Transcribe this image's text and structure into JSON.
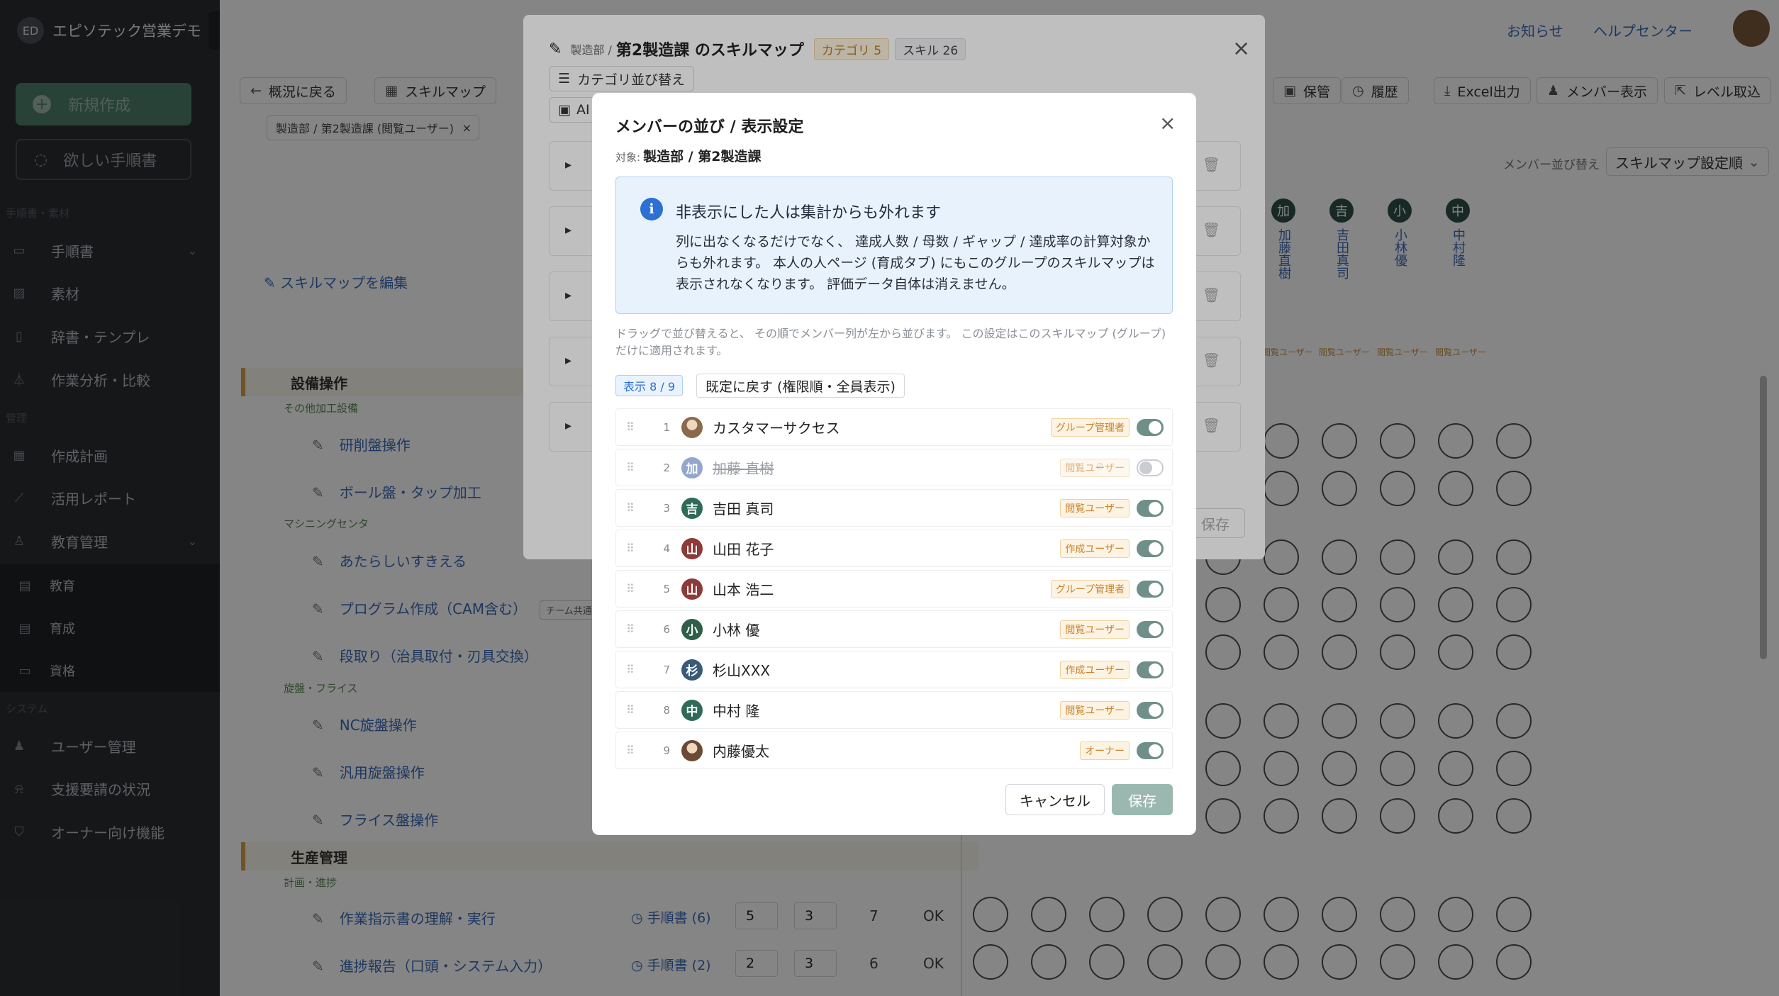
{
  "sidebar": {
    "org_name": "エピソテック営業デモ",
    "logo_text": "ED",
    "new_button": "新規作成",
    "want_button": "欲しい手順書",
    "section_manual": "手順書・素材",
    "section_manage": "管理",
    "section_system": "システム",
    "items": {
      "manual": "手順書",
      "material": "素材",
      "dictionary": "辞書・テンプレ",
      "analysis": "作業分析・比較",
      "plan": "作成計画",
      "report": "活用レポート",
      "education": "教育管理",
      "edu_sub": "教育",
      "training_sub": "育成",
      "qualification_sub": "資格",
      "users": "ユーザー管理",
      "support": "支援要請の状況",
      "owner": "オーナー向け機能"
    }
  },
  "topbar": {
    "news": "お知らせ",
    "help": "ヘルプセンター"
  },
  "toolbar": {
    "back": "概況に戻る",
    "skillmap": "スキルマップ",
    "archive": "保管",
    "history": "履歴",
    "excel": "Excel出力",
    "members": "メンバー表示",
    "level_import": "レベル取込"
  },
  "filter_chip": "製造部 / 第2製造課 (閲覧ユーザー)",
  "edit_skillmap": "スキルマップを編集",
  "member_sort_label": "メンバー並び替え",
  "member_sort_value": "スキルマップ設定順",
  "background": {
    "categories": [
      {
        "name": "設備操作"
      },
      {
        "name": "生産管理"
      }
    ],
    "subcategories": [
      "その他加工設備",
      "マシニングセンタ",
      "旋盤・フライス",
      "計画・進捗"
    ],
    "skills": [
      "研削盤操作",
      "ボール盤・タップ加工",
      "あたらしいすきえる",
      "プログラム作成（CAM含む）",
      "段取り（治具取付・刃具交換）",
      "NC旋盤操作",
      "汎用旋盤操作",
      "フライス盤操作",
      "作業指示書の理解・実行",
      "進捗報告（口頭・システム入力）"
    ],
    "team_tag": "チーム共通",
    "manual_links": [
      "手順書 (6)",
      "手順書 (2)"
    ],
    "nums": [
      [
        "5",
        "3",
        "7",
        "OK"
      ],
      [
        "2",
        "3",
        "6",
        "OK"
      ]
    ],
    "member_columns": [
      {
        "initial": "加",
        "name": "加藤直樹"
      },
      {
        "initial": "吉",
        "name": "吉田真司"
      },
      {
        "initial": "小",
        "name": "小林優"
      },
      {
        "initial": "中",
        "name": "中村隆"
      }
    ],
    "role_mini": "閲覧ユーザー"
  },
  "skillmap_modal": {
    "breadcrumb": "製造部 /",
    "title": "第2製造課 のスキルマップ",
    "category_badge": "カテゴリ 5",
    "skill_badge": "スキル 26",
    "sort_button": "カテゴリ並び替え",
    "ai_button": "AI",
    "save": "保存"
  },
  "member_dialog": {
    "title": "メンバーの並び / 表示設定",
    "target_label": "対象:",
    "target_value": "製造部 / 第2製造課",
    "info_title": "非表示にした人は集計からも外れます",
    "info_body": "列に出なくなるだけでなく、 達成人数 / 母数 / ギャップ / 達成率の計算対象からも外れます。 本人の人ページ (育成タブ) にもこのグループのスキルマップは表示されなくなります。 評価データ自体は消えません。",
    "hint": "ドラッグで並び替えると、 その順でメンバー列が左から並びます。 この設定はこのスキルマップ (グループ) だけに適用されます。",
    "count_badge": "表示 8 / 9",
    "reset_button": "既定に戻す (権限順・全員表示)",
    "cancel": "キャンセル",
    "save": "保存",
    "members": [
      {
        "num": "1",
        "initial": "カ",
        "name": "カスタマーサクセス",
        "role": "グループ管理者",
        "visible": true,
        "color": "#8a6a4a",
        "photo": true
      },
      {
        "num": "2",
        "initial": "加",
        "name": "加藤 直樹",
        "role": "閲覧ユーザー",
        "visible": false,
        "color": "#3b5fa8",
        "photo": false
      },
      {
        "num": "3",
        "initial": "吉",
        "name": "吉田 真司",
        "role": "閲覧ユーザー",
        "visible": true,
        "color": "#2f6b57",
        "photo": false
      },
      {
        "num": "4",
        "initial": "山",
        "name": "山田 花子",
        "role": "作成ユーザー",
        "visible": true,
        "color": "#8c3a3a",
        "photo": false
      },
      {
        "num": "5",
        "initial": "山",
        "name": "山本 浩二",
        "role": "グループ管理者",
        "visible": true,
        "color": "#8c3a3a",
        "photo": false
      },
      {
        "num": "6",
        "initial": "小",
        "name": "小林 優",
        "role": "閲覧ユーザー",
        "visible": true,
        "color": "#2f5e4a",
        "photo": false
      },
      {
        "num": "7",
        "initial": "杉",
        "name": "杉山XXX",
        "role": "作成ユーザー",
        "visible": true,
        "color": "#3a5a78",
        "photo": false
      },
      {
        "num": "8",
        "initial": "中",
        "name": "中村 隆",
        "role": "閲覧ユーザー",
        "visible": true,
        "color": "#2f6b57",
        "photo": false
      },
      {
        "num": "9",
        "initial": "内",
        "name": "内藤優太",
        "role": "オーナー",
        "visible": true,
        "color": "#6b4a35",
        "photo": true
      }
    ]
  },
  "colors": {
    "accent_green": "#6f8f88",
    "info_blue": "#2d6fd3",
    "role_orange": "#c9822a",
    "sidebar_bg": "#2a2d31"
  }
}
